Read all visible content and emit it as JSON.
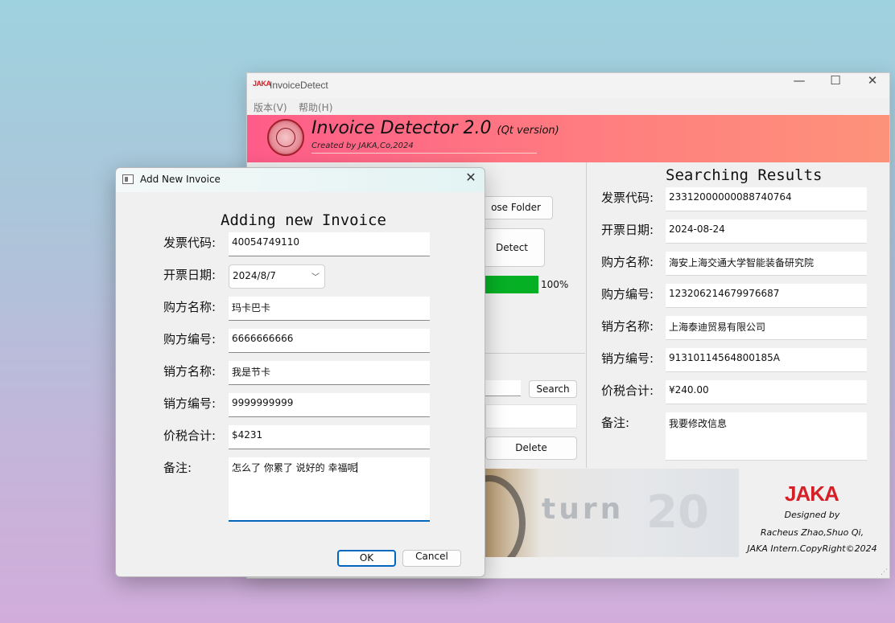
{
  "main_window": {
    "title": "InvoiceDetect",
    "logo_text": "JAKA",
    "controls": {
      "minimize": "—",
      "maximize": "☐",
      "close": "✕"
    },
    "menu": [
      "版本(V)",
      "帮助(H)"
    ],
    "banner": {
      "title": "Invoice Detector 2.0",
      "subtitle": "(Qt version)",
      "credit": "Created by JAKA,Co,2024"
    },
    "buttons": {
      "choose_folder": "ose Folder",
      "detect": "Detect",
      "search": "Search",
      "delete": "Delete"
    },
    "progress": {
      "percent": 100,
      "text": "100%"
    },
    "photo_text": {
      "word": "turn",
      "number": "20"
    },
    "results": {
      "title": "Searching Results",
      "fields": [
        {
          "label": "发票代码:",
          "value": "23312000000088740764"
        },
        {
          "label": "开票日期:",
          "value": "2024-08-24"
        },
        {
          "label": "购方名称:",
          "value": "海安上海交通大学智能装备研究院"
        },
        {
          "label": "购方编号:",
          "value": "123206214679976687"
        },
        {
          "label": "销方名称:",
          "value": "上海泰迪贸易有限公司"
        },
        {
          "label": "销方编号:",
          "value": "91310114564800185A"
        },
        {
          "label": "价税合计:",
          "value": "¥240.00"
        },
        {
          "label": "备注:",
          "value": "我要修改信息"
        }
      ]
    },
    "footer": {
      "logo": "JAKA",
      "designed_by": "Designed by",
      "authors": "Racheus Zhao,Shuo Qi,",
      "copyright": "JAKA Intern.CopyRight©2024"
    }
  },
  "dialog": {
    "title": "Add New Invoice",
    "close": "✕",
    "heading": "Adding new Invoice",
    "fields": [
      {
        "label": "发票代码:",
        "value": "40054749110"
      },
      {
        "label": "开票日期:",
        "value": "2024/8/7"
      },
      {
        "label": "购方名称:",
        "value": "玛卡巴卡"
      },
      {
        "label": "购方编号:",
        "value": "6666666666"
      },
      {
        "label": "销方名称:",
        "value": "我是节卡"
      },
      {
        "label": "销方编号:",
        "value": "9999999999"
      },
      {
        "label": "价税合计:",
        "value": "$4231"
      },
      {
        "label": "备注:",
        "value": "怎么了 你累了 说好的  幸福呢"
      }
    ],
    "ok": "OK",
    "cancel": "Cancel"
  },
  "colors": {
    "banner_start": "#fe5c89",
    "banner_end": "#fd927a",
    "progress": "#06b025",
    "accent": "#0067c0",
    "brand_red": "#d62027"
  }
}
